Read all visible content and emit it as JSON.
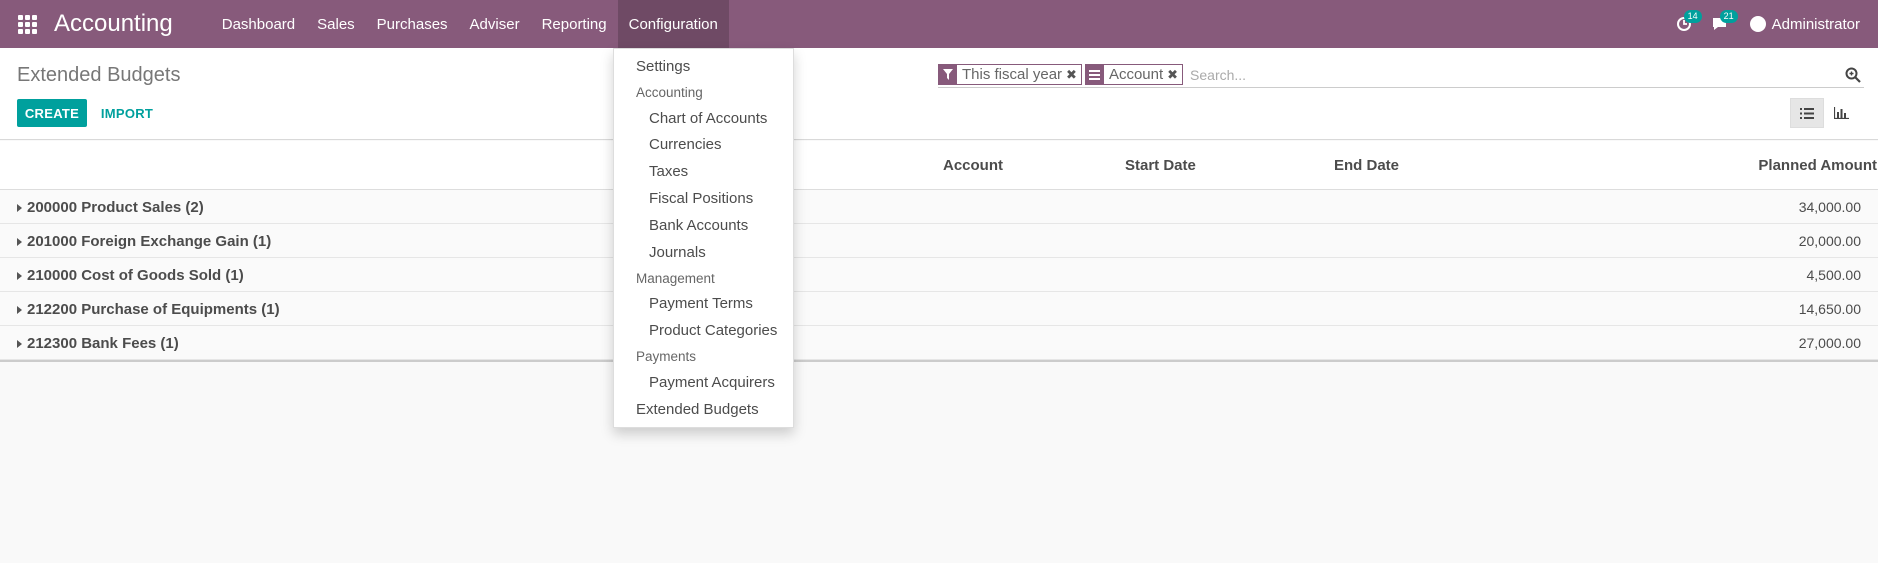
{
  "navbar": {
    "app_title": "Accounting",
    "menu": [
      "Dashboard",
      "Sales",
      "Purchases",
      "Adviser",
      "Reporting",
      "Configuration"
    ],
    "activities_count": "14",
    "messages_count": "21",
    "user": "Administrator"
  },
  "control_panel": {
    "breadcrumb": "Extended Budgets",
    "create_label": "CREATE",
    "import_label": "IMPORT",
    "facets": [
      "This fiscal year",
      "Account"
    ],
    "search_placeholder": "Search..."
  },
  "list": {
    "columns": [
      "Account",
      "Start Date",
      "End Date",
      "Planned Amount"
    ],
    "groups": [
      {
        "name": "200000 Product Sales (2)",
        "amount": "34,000.00"
      },
      {
        "name": "201000 Foreign Exchange Gain (1)",
        "amount": "20,000.00"
      },
      {
        "name": "210000 Cost of Goods Sold (1)",
        "amount": "4,500.00"
      },
      {
        "name": "212200 Purchase of Equipments (1)",
        "amount": "14,650.00"
      },
      {
        "name": "212300 Bank Fees (1)",
        "amount": "27,000.00"
      }
    ]
  },
  "dropdown": {
    "settings": "Settings",
    "accounting_header": "Accounting",
    "chart_of_accounts": "Chart of Accounts",
    "currencies": "Currencies",
    "taxes": "Taxes",
    "fiscal_positions": "Fiscal Positions",
    "bank_accounts": "Bank Accounts",
    "journals": "Journals",
    "management_header": "Management",
    "payment_terms": "Payment Terms",
    "product_categories": "Product Categories",
    "payments_header": "Payments",
    "payment_acquirers": "Payment Acquirers",
    "extended_budgets": "Extended Budgets"
  },
  "colors": {
    "brand": "#875a7b",
    "accent": "#00a09d"
  }
}
